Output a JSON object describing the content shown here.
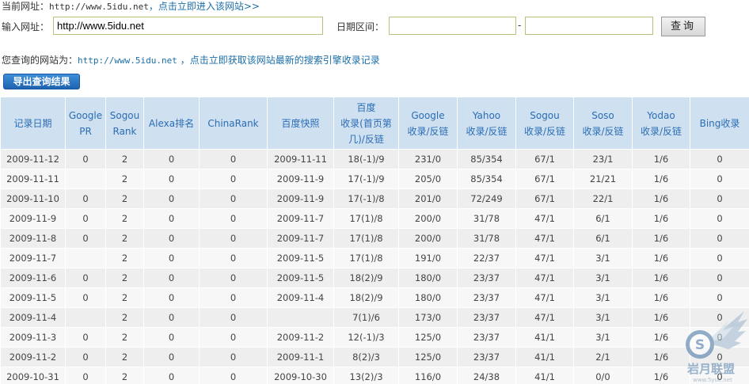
{
  "current_site": {
    "label": "当前网址：",
    "url": "http://www.5idu.net",
    "link": "，点击立即进入该网站>>"
  },
  "query": {
    "input_label": "输入网址：",
    "input_value": "http://www.5idu.net",
    "date_label": "日期区间：",
    "date_from": "",
    "date_to": "",
    "dash": "-",
    "submit_label": "查询"
  },
  "result_note": {
    "prefix": "您查询的网站为：",
    "url": "http://www.5idu.net",
    "link": "，点击立即获取该网站最新的搜索引擎收录记录"
  },
  "export_label": "导出查询结果",
  "table": {
    "headers": [
      [
        "记录日期"
      ],
      [
        "Google",
        "PR"
      ],
      [
        "Sogou",
        "Rank"
      ],
      [
        "Alexa排名"
      ],
      [
        "ChinaRank"
      ],
      [
        "百度快照"
      ],
      [
        "百度",
        "收录(首页第",
        "几)/反链"
      ],
      [
        "Google",
        "收录/反链"
      ],
      [
        "Yahoo",
        "收录/反链"
      ],
      [
        "Sogou",
        "收录/反链"
      ],
      [
        "Soso",
        "收录/反链"
      ],
      [
        "Yodao",
        "收录/反链"
      ],
      [
        "Bing收录"
      ]
    ],
    "rows": [
      [
        "2009-11-12",
        "0",
        "2",
        "0",
        "0",
        "2009-11-11",
        "18(-1)/9",
        "231/0",
        "85/354",
        "67/1",
        "23/1",
        "1/6",
        "0"
      ],
      [
        "2009-11-11",
        "",
        "2",
        "0",
        "0",
        "2009-11-9",
        "17(-1)/9",
        "205/0",
        "85/354",
        "67/1",
        "21/21",
        "1/6",
        "0"
      ],
      [
        "2009-11-10",
        "0",
        "2",
        "0",
        "0",
        "2009-11-9",
        "17(-1)/8",
        "201/0",
        "72/249",
        "67/1",
        "22/1",
        "1/6",
        "0"
      ],
      [
        "2009-11-9",
        "0",
        "2",
        "0",
        "0",
        "2009-11-7",
        "17(1)/8",
        "200/0",
        "31/78",
        "47/1",
        "6/1",
        "1/6",
        "0"
      ],
      [
        "2009-11-8",
        "0",
        "2",
        "0",
        "0",
        "2009-11-7",
        "17(1)/8",
        "200/0",
        "31/78",
        "47/1",
        "6/1",
        "1/6",
        "0"
      ],
      [
        "2009-11-7",
        "",
        "2",
        "0",
        "0",
        "2009-11-5",
        "17(1)/8",
        "191/0",
        "22/37",
        "47/1",
        "3/1",
        "1/6",
        "0"
      ],
      [
        "2009-11-6",
        "0",
        "2",
        "0",
        "0",
        "2009-11-5",
        "18(2)/9",
        "180/0",
        "23/37",
        "47/1",
        "3/1",
        "1/6",
        "0"
      ],
      [
        "2009-11-5",
        "0",
        "2",
        "0",
        "0",
        "2009-11-4",
        "18(2)/9",
        "180/0",
        "23/37",
        "47/1",
        "3/1",
        "1/6",
        "0"
      ],
      [
        "2009-11-4",
        "",
        "2",
        "0",
        "0",
        "",
        "7(1)/6",
        "173/0",
        "23/37",
        "47/1",
        "3/1",
        "1/6",
        "0"
      ],
      [
        "2009-11-3",
        "0",
        "2",
        "0",
        "0",
        "2009-11-2",
        "12(-1)/3",
        "125/0",
        "23/37",
        "41/1",
        "3/1",
        "1/6",
        "0"
      ],
      [
        "2009-11-2",
        "0",
        "2",
        "0",
        "0",
        "2009-11-1",
        "8(2)/3",
        "125/0",
        "23/37",
        "41/1",
        "2/1",
        "1/6",
        "0"
      ],
      [
        "2009-10-31",
        "0",
        "2",
        "0",
        "0",
        "2009-10-30",
        "13(2)/3",
        "116/0",
        "24/38",
        "41/1",
        "0/0",
        "1/6",
        "0"
      ]
    ]
  },
  "watermark": {
    "text": "岩月联盟",
    "sub": "www.5yue.net",
    "badge": "S"
  },
  "colors": {
    "header_bg": "#cfe0f0",
    "header_text": "#2a6db5",
    "link": "#1a6ea8",
    "row_odd": "#eeeeee",
    "row_even": "#f7f7f7",
    "export_button": "#2a74c4"
  }
}
